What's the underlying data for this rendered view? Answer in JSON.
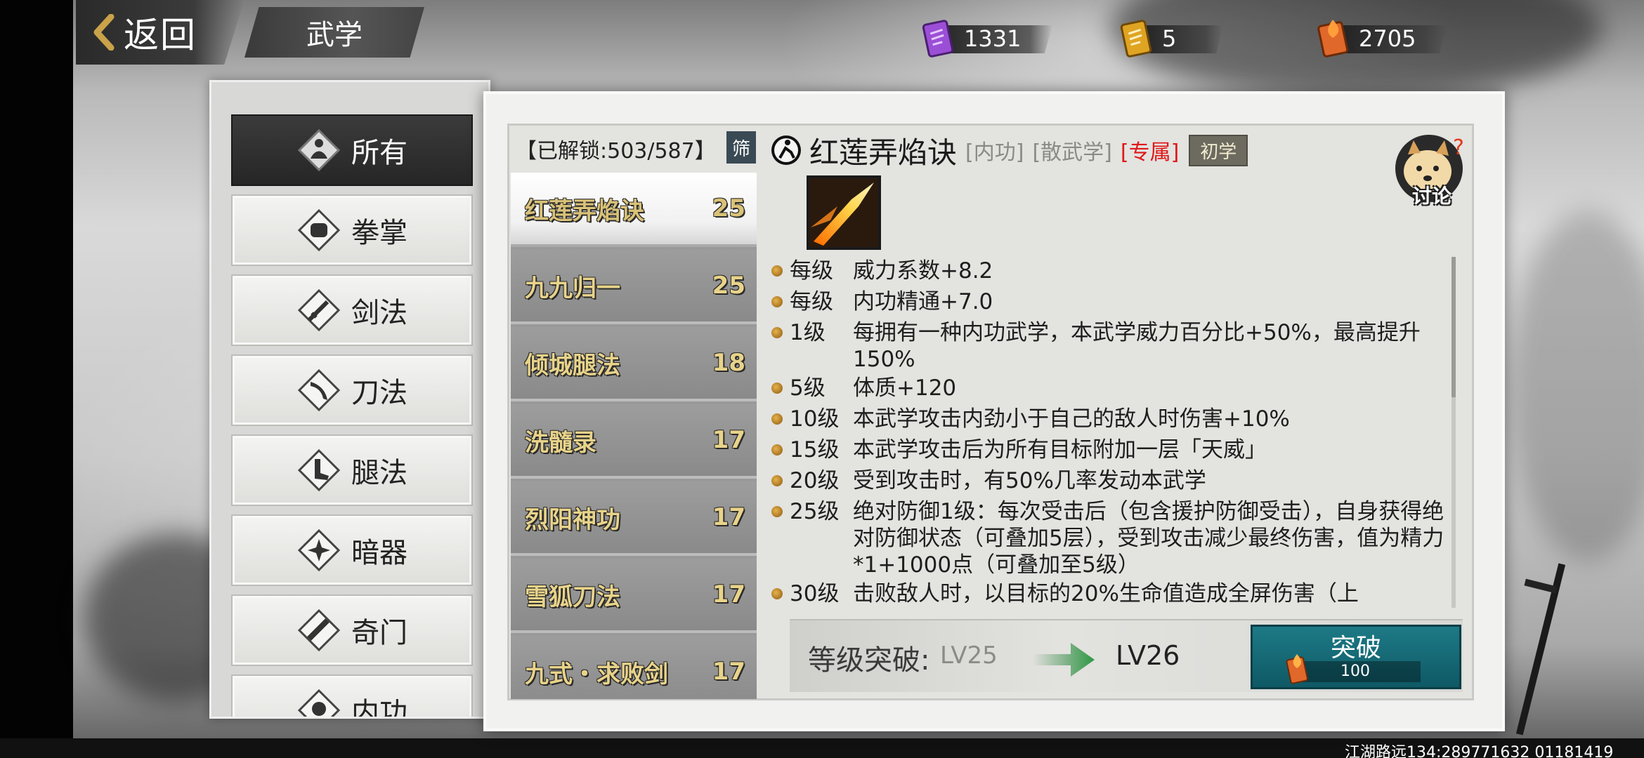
{
  "header": {
    "back_label": "返回",
    "section_title": "武学"
  },
  "currencies": [
    {
      "icon": "purple-scroll-icon",
      "value": "1331",
      "color": "#9b4fd6"
    },
    {
      "icon": "gold-scroll-icon",
      "value": "5",
      "color": "#e0a423"
    },
    {
      "icon": "flame-scroll-icon",
      "value": "2705",
      "color": "#e0682a"
    }
  ],
  "categories": [
    {
      "label": "所有",
      "icon": "meditation-icon",
      "active": true
    },
    {
      "label": "拳掌",
      "icon": "fist-icon",
      "active": false
    },
    {
      "label": "剑法",
      "icon": "sword-icon",
      "active": false
    },
    {
      "label": "刀法",
      "icon": "blade-icon",
      "active": false
    },
    {
      "label": "腿法",
      "icon": "kick-icon",
      "active": false
    },
    {
      "label": "暗器",
      "icon": "shuriken-icon",
      "active": false
    },
    {
      "label": "奇门",
      "icon": "scroll-weapon-icon",
      "active": false
    },
    {
      "label": "内功",
      "icon": "inner-power-icon",
      "active": false
    }
  ],
  "skill_list": {
    "header": "【已解锁:503/587】",
    "filter_label": "筛",
    "items": [
      {
        "name": "红莲弄焰诀",
        "level": "25",
        "active": true
      },
      {
        "name": "九九归一",
        "level": "25",
        "active": false
      },
      {
        "name": "倾城腿法",
        "level": "18",
        "active": false
      },
      {
        "name": "洗髓录",
        "level": "17",
        "active": false
      },
      {
        "name": "烈阳神功",
        "level": "17",
        "active": false
      },
      {
        "name": "雪狐刀法",
        "level": "17",
        "active": false
      },
      {
        "name": "九式・求败剑",
        "level": "17",
        "active": false
      }
    ]
  },
  "detail": {
    "name": "红莲弄焰诀",
    "tags": [
      "[内功]",
      "[散武学]",
      "[专属]"
    ],
    "rank": "初学",
    "discuss_label": "讨论",
    "effects": [
      {
        "level": "每级",
        "text": "威力系数+8.2"
      },
      {
        "level": "每级",
        "text": "内功精通+7.0"
      },
      {
        "level": "1级",
        "text": "每拥有一种内功武学，本武学威力百分比+50%，最高提升150%"
      },
      {
        "level": "5级",
        "text": "体质+120"
      },
      {
        "level": "10级",
        "text": "本武学攻击内劲小于自己的敌人时伤害+10%"
      },
      {
        "level": "15级",
        "text": "本武学攻击后为所有目标附加一层「天威」"
      },
      {
        "level": "20级",
        "text": "受到攻击时，有50%几率发动本武学"
      },
      {
        "level": "25级",
        "text": "绝对防御1级：每次受击后（包含援护防御受击），自身获得绝对防御状态（可叠加5层），受到攻击减少最终伤害，值为精力*1+1000点（可叠加至5级）"
      },
      {
        "level": "30级",
        "text": "击败敌人时，以目标的20%生命值造成全屏伤害（上"
      }
    ],
    "breakthrough": {
      "label": "等级突破:",
      "current": "LV25",
      "next": "LV26",
      "button_label": "突破",
      "cost": "100"
    }
  },
  "watermark": "江湖路远134:289771632 01181419"
}
